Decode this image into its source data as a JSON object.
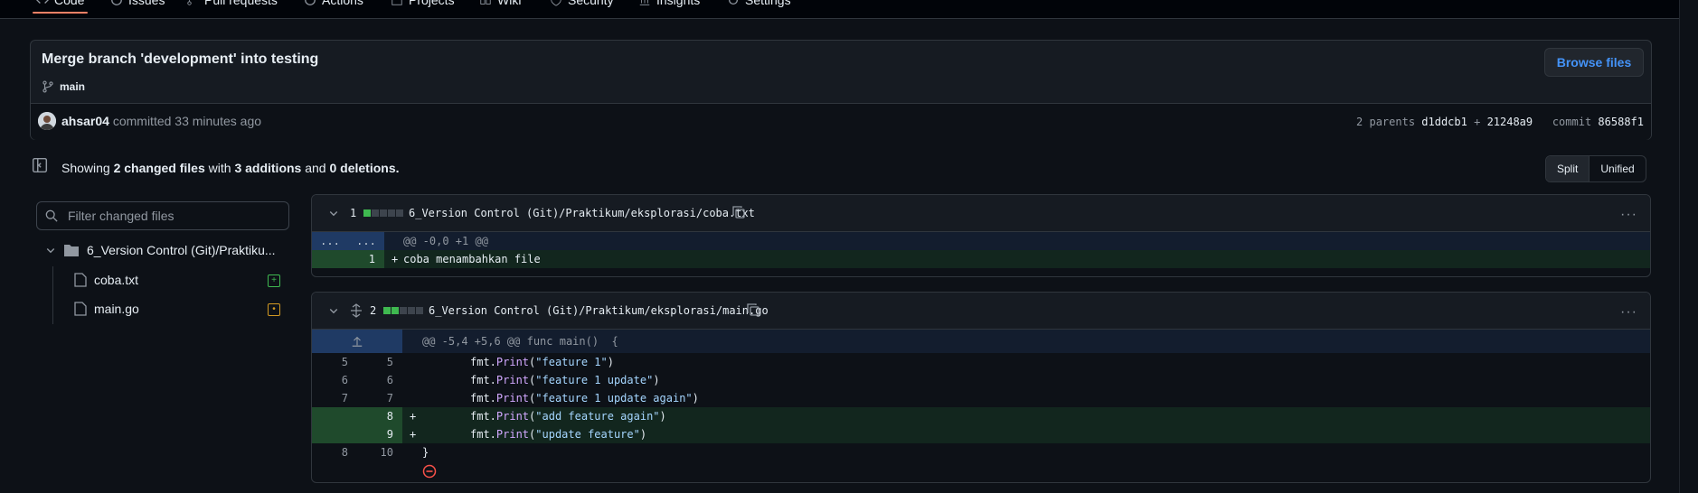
{
  "nav": {
    "tabs": [
      "Code",
      "Issues",
      "Pull requests",
      "Actions",
      "Projects",
      "Wiki",
      "Security",
      "Insights",
      "Settings"
    ]
  },
  "commit": {
    "title": "Merge branch 'development' into testing",
    "branch": "main",
    "browse_label": "Browse files",
    "author": "ahsar04",
    "committed_text": "committed 33 minutes ago",
    "parents_label": "2 parents",
    "parent1": "d1ddcb1",
    "plus": "+",
    "parent2": "21248a9",
    "commit_label": "commit",
    "commit_sha": "86588f1"
  },
  "summary": {
    "prefix": "Showing",
    "files": "2 changed files",
    "with": "with",
    "additions": "3 additions",
    "and": "and",
    "deletions": "0 deletions."
  },
  "view_toggle": {
    "split": "Split",
    "unified": "Unified"
  },
  "filter": {
    "placeholder": "Filter changed files"
  },
  "tree": {
    "folder": "6_Version Control (Git)/Praktiku...",
    "files": [
      "coba.txt",
      "main.go"
    ],
    "file_status": [
      "added",
      "modified"
    ]
  },
  "diff1": {
    "count": "1",
    "path": "6_Version Control (Git)/Praktikum/eksplorasi/coba.txt",
    "diffstat": {
      "additions": 1,
      "blocks": 5,
      "green_blocks": 1
    },
    "hunk_ellipsis": "...",
    "hunk": "@@ -0,0 +1 @@",
    "lines": [
      {
        "old": "",
        "new": "1",
        "sign": "+",
        "text": "coba menambahkan file"
      }
    ]
  },
  "diff2": {
    "count": "2",
    "path": "6_Version Control (Git)/Praktikum/eksplorasi/main.go",
    "diffstat": {
      "additions": 2,
      "blocks": 5,
      "green_blocks": 2
    },
    "hunk": "@@ -5,4 +5,6 @@ func main()  {",
    "lines": [
      {
        "old": "5",
        "new": "5",
        "sign": "",
        "recv": "fmt.",
        "fn": "Print",
        "arg": "\"feature 1\""
      },
      {
        "old": "6",
        "new": "6",
        "sign": "",
        "recv": "fmt.",
        "fn": "Print",
        "arg": "\"feature 1 update\""
      },
      {
        "old": "7",
        "new": "7",
        "sign": "",
        "recv": "fmt.",
        "fn": "Print",
        "arg": "\"feature 1 update again\""
      },
      {
        "old": "",
        "new": "8",
        "sign": "+",
        "recv": "fmt.",
        "fn": "Print",
        "arg": "\"add feature again\""
      },
      {
        "old": "",
        "new": "9",
        "sign": "+",
        "recv": "fmt.",
        "fn": "Print",
        "arg": "\"update feature\""
      },
      {
        "old": "8",
        "new": "10",
        "sign": "",
        "text": "}"
      }
    ],
    "no_newline_icon": "no-newline-icon"
  },
  "colors": {
    "accent": "#4493f8",
    "added": "#3fb950",
    "modified": "#d29922",
    "removed": "#f85149"
  }
}
